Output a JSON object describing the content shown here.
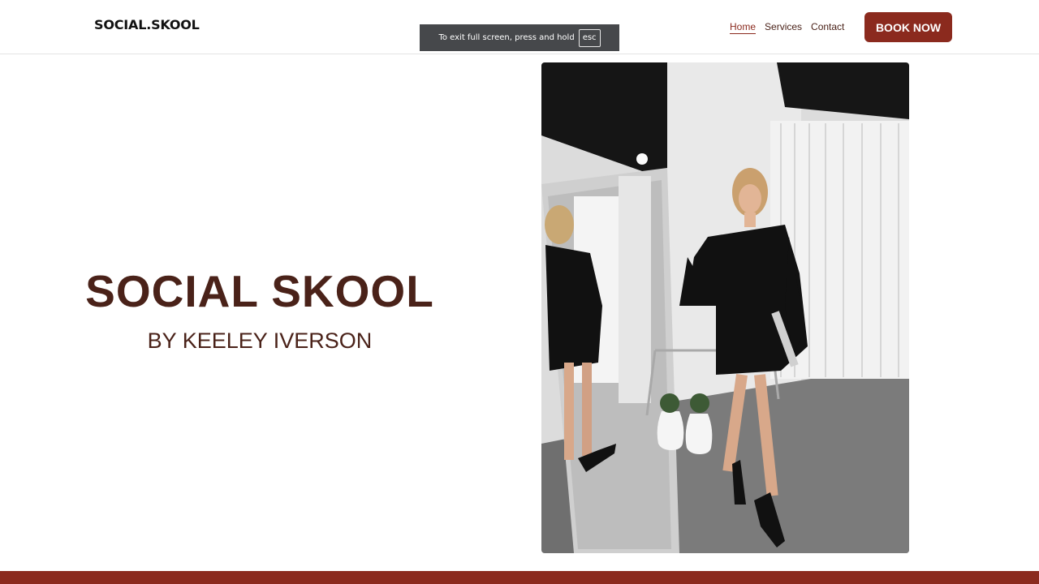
{
  "header": {
    "logo": "SOCIAL.SKOOL",
    "nav": [
      {
        "label": "Home",
        "active": true
      },
      {
        "label": "Services",
        "active": false
      },
      {
        "label": "Contact",
        "active": false
      }
    ],
    "cta_label": "BOOK NOW"
  },
  "fullscreen_notice": {
    "text": "To exit full screen, press and hold",
    "key": "esc"
  },
  "hero": {
    "title": "SOCIAL SKOOL",
    "subtitle": "BY KEELEY IVERSON"
  },
  "colors": {
    "accent": "#8b2a1e",
    "text": "#4a2219"
  }
}
